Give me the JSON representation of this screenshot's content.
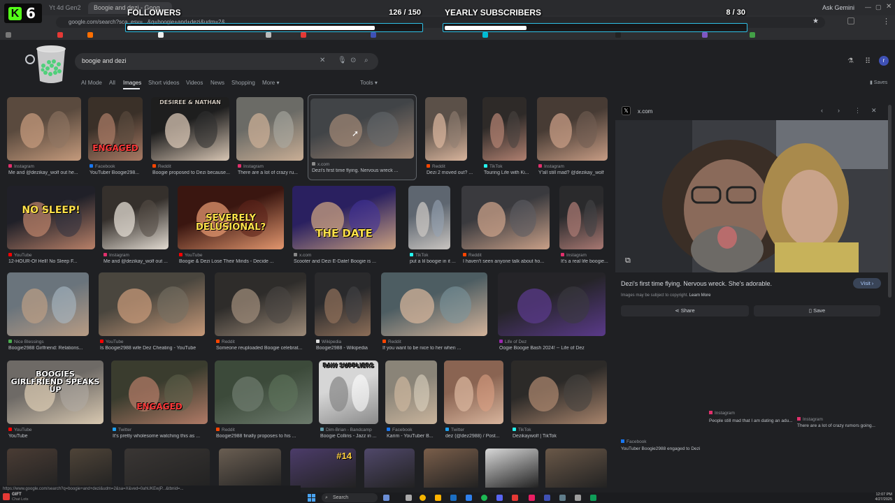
{
  "browser": {
    "tabs": [
      "Yt 4d Gen2",
      "Boogie and dezi - Goog...",
      "",
      "Ask Gemini"
    ],
    "url": "google.com/search?sca_esv=...&q=boogie+and+dezi&udm=2&...",
    "download_status": "https://www.google.com/search?q=boogie+and+dezi&udm=2&sa=X&ved=0ahUKEwjP...&tbnid=..."
  },
  "overlay": {
    "platform_letter": "K",
    "viewer_count": "6",
    "followers": {
      "label": "FOLLOWERS",
      "count": "126 / 150",
      "progress": 0.84
    },
    "subscribers": {
      "label": "YEARLY SUBSCRIBERS",
      "count": "8 / 30",
      "progress": 0.27
    }
  },
  "google": {
    "query": "boogie and dezi",
    "tabs": [
      "AI Mode",
      "All",
      "Images",
      "Short videos",
      "Videos",
      "News",
      "Shopping",
      "More"
    ],
    "active_tab": "Images",
    "tools": "Tools",
    "saves": "Saves",
    "avatar_letter": "r"
  },
  "results": [
    {
      "src": "Instagram",
      "title": "Me and @dezikay_wolf out he...",
      "color": "#e1306c"
    },
    {
      "src": "Facebook",
      "title": "YouTuber Boogie298...",
      "color": "#1877f2",
      "overlay": "ENGAGED"
    },
    {
      "src": "Reddit",
      "title": "Boogie proposed to Dezi because...",
      "color": "#ff4500",
      "overlay": "DESIREE & NATHAN"
    },
    {
      "src": "Instagram",
      "title": "There are a lot of crazy ru...",
      "color": "#e1306c"
    },
    {
      "src": "x.com",
      "title": "Dezi's first time flying. Nervous wreck ...",
      "color": "#888888"
    },
    {
      "src": "Reddit",
      "title": "Dezi 2 moved out? ...",
      "color": "#ff4500"
    },
    {
      "src": "TikTok",
      "title": "Touring Life with Ki...",
      "color": "#25f4ee"
    },
    {
      "src": "Instagram",
      "title": "Y'all still mad? @dezikay_wolf",
      "color": "#e1306c"
    },
    {
      "src": "YouTube",
      "title": "12-HOUR-Of Hell! No Sleep F...",
      "color": "#ff0000",
      "overlay": "NO SLEEP!"
    },
    {
      "src": "Instagram",
      "title": "Me and @dezikay_wolf out ...",
      "color": "#e1306c"
    },
    {
      "src": "YouTube",
      "title": "Boogie & Dezi Lose Their Minds - Decide ...",
      "color": "#ff0000",
      "overlay": "SEVERELY DELUSIONAL?"
    },
    {
      "src": "x.com",
      "title": "Scooter and Dezi E-Date! Boogie is ...",
      "color": "#888888",
      "overlay": "THE DATE"
    },
    {
      "src": "TikTok",
      "title": "put a lil boogie in it ...",
      "color": "#25f4ee"
    },
    {
      "src": "Reddit",
      "title": "I haven't seen anyone talk about ho...",
      "color": "#ff4500"
    },
    {
      "src": "Instagram",
      "title": "It's a real life boogie...",
      "color": "#e1306c"
    },
    {
      "src": "Nice Blessings",
      "title": "Boogie2988 Girlfriend: Relations...",
      "color": "#4caf50"
    },
    {
      "src": "YouTube",
      "title": "Is Boogie2988 wife Dez Cheating - YouTube",
      "color": "#ff0000"
    },
    {
      "src": "Reddit",
      "title": "Someone reuploaded Boogie celebrat...",
      "color": "#ff4500"
    },
    {
      "src": "Wikipedia",
      "title": "Boogie2988 - Wikipedia",
      "color": "#dddddd"
    },
    {
      "src": "Reddit",
      "title": "If you want to be nice to her when ...",
      "color": "#ff4500"
    },
    {
      "src": "Life of Dez",
      "title": "Oogie Boogie Bash 2024! -- Life of Dez",
      "color": "#9c27b0"
    },
    {
      "src": "YouTube",
      "title": "YouTube",
      "color": "#ff0000",
      "overlay": "BOOGIES GIRLFRIEND SPEAKS UP"
    },
    {
      "src": "Twitter",
      "title": "It's pretty wholesome watching this as ...",
      "color": "#1da1f2",
      "overlay": "ENGAGED"
    },
    {
      "src": "Reddit",
      "title": "Boogie2988 finally proposes to his ...",
      "color": "#ff4500"
    },
    {
      "src": "Dim-Brian - Bandcamp",
      "title": "Boogie Collins - Jazz in ...",
      "color": "#629aa9",
      "overlay": "RAW SUPPLIERS"
    },
    {
      "src": "Facebook",
      "title": "Karim - YouTuber B...",
      "color": "#1877f2"
    },
    {
      "src": "Twitter",
      "title": "dez (@dez2988) / Post...",
      "color": "#1da1f2"
    },
    {
      "src": "TikTok",
      "title": "Dezikaywolf | TikTok",
      "color": "#25f4ee"
    }
  ],
  "bottom_row_overlay": "#14",
  "preview": {
    "source": "x.com",
    "caption": "Dezi's first time flying. Nervous wreck. She's adorable.",
    "visit": "Visit",
    "copyright": "Images may be subject to copyright.",
    "learn_more": "Learn More",
    "share": "Share",
    "save": "Save",
    "related": [
      {
        "src": "Instagram",
        "title": "People still mad that I am dating an adu..."
      },
      {
        "src": "Instagram",
        "title": "There are a lot of crazy rumors going..."
      },
      {
        "src": "Facebook",
        "title": "YouTuber Boogie2988 engaged to Dezi"
      }
    ]
  },
  "taskbar": {
    "search": "Search",
    "time": "12:07 PM",
    "date": "4/27/2025",
    "gift_label": "GIFT",
    "gift_sub": "Chat Lots"
  }
}
